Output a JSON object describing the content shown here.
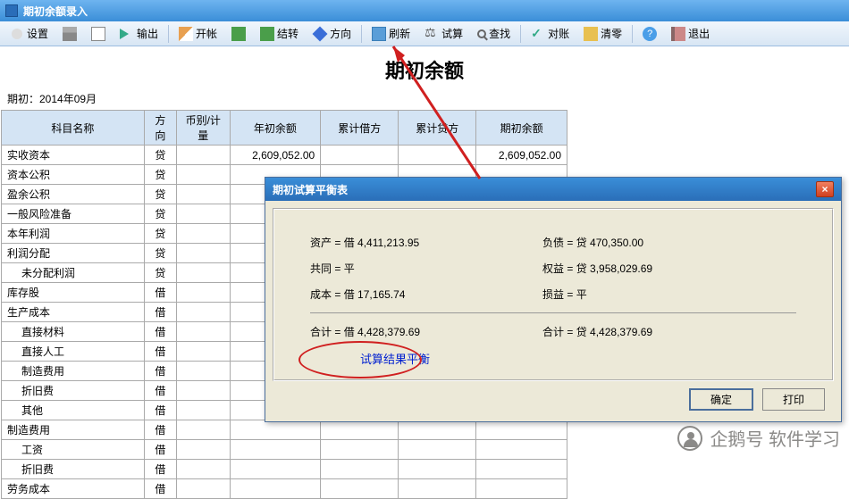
{
  "window_title": "期初余额录入",
  "toolbar": [
    {
      "name": "settings",
      "label": "设置",
      "icon": "ic-gear"
    },
    {
      "name": "print",
      "label": "",
      "icon": "ic-print"
    },
    {
      "name": "doc",
      "label": "",
      "icon": "ic-doc"
    },
    {
      "name": "export",
      "label": "输出",
      "icon": "ic-out"
    },
    {
      "sep": true
    },
    {
      "name": "open",
      "label": "开帐",
      "icon": "ic-edit"
    },
    {
      "name": "g1",
      "label": "",
      "icon": "ic-green"
    },
    {
      "name": "carry",
      "label": "结转",
      "icon": "ic-green"
    },
    {
      "name": "dir",
      "label": "方向",
      "icon": "ic-dia"
    },
    {
      "sep": true
    },
    {
      "name": "refresh",
      "label": "刷新",
      "icon": "ic-blue"
    },
    {
      "name": "trial",
      "label": "试算",
      "icon": "ic-scale"
    },
    {
      "name": "find",
      "label": "查找",
      "icon": "ic-mag"
    },
    {
      "sep": true
    },
    {
      "name": "recon",
      "label": "对账",
      "icon": "ic-check"
    },
    {
      "name": "clear",
      "label": "清零",
      "icon": "ic-yel"
    },
    {
      "sep": true
    },
    {
      "name": "help",
      "label": "",
      "icon": "ic-q"
    },
    {
      "name": "exit",
      "label": "退出",
      "icon": "ic-door"
    }
  ],
  "page_title": "期初余额",
  "period_label": "期初：2014年09月",
  "columns": [
    "科目名称",
    "方向",
    "币别/计量",
    "年初余额",
    "累计借方",
    "累计贷方",
    "期初余额"
  ],
  "rows": [
    {
      "name": "实收资本",
      "dir": "贷",
      "y0": "2,609,052.00",
      "db": "",
      "cr": "",
      "bal": "2,609,052.00"
    },
    {
      "name": "资本公积",
      "dir": "贷"
    },
    {
      "name": "盈余公积",
      "dir": "贷"
    },
    {
      "name": "一般风险准备",
      "dir": "贷"
    },
    {
      "name": "本年利润",
      "dir": "贷"
    },
    {
      "name": "利润分配",
      "dir": "贷"
    },
    {
      "name": "未分配利润",
      "dir": "贷",
      "indent": 1
    },
    {
      "name": "库存股",
      "dir": "借"
    },
    {
      "name": "生产成本",
      "dir": "借"
    },
    {
      "name": "直接材料",
      "dir": "借",
      "indent": 1
    },
    {
      "name": "直接人工",
      "dir": "借",
      "indent": 1
    },
    {
      "name": "制造费用",
      "dir": "借",
      "indent": 1
    },
    {
      "name": "折旧费",
      "dir": "借",
      "indent": 1
    },
    {
      "name": "其他",
      "dir": "借",
      "indent": 1
    },
    {
      "name": "制造费用",
      "dir": "借"
    },
    {
      "name": "工资",
      "dir": "借",
      "indent": 1
    },
    {
      "name": "折旧费",
      "dir": "借",
      "indent": 1
    },
    {
      "name": "劳务成本",
      "dir": "借"
    }
  ],
  "dialog": {
    "title": "期初试算平衡表",
    "asset_l": "资产",
    "asset_v": "= 借 4,411,213.95",
    "liab_l": "负债",
    "liab_v": "= 贷 470,350.00",
    "comm_l": "共同",
    "comm_v": "= 平",
    "eq_l": "权益",
    "eq_v": "= 贷 3,958,029.69",
    "cost_l": "成本",
    "cost_v": "= 借 17,165.74",
    "pl_l": "损益",
    "pl_v": "= 平",
    "tot1_l": "合计",
    "tot1_v": "= 借 4,428,379.69",
    "tot2_l": "合计",
    "tot2_v": "= 贷 4,428,379.69",
    "result": "试算结果平衡",
    "ok": "确定",
    "print": "打印"
  },
  "watermark": "企鹅号 软件学习"
}
